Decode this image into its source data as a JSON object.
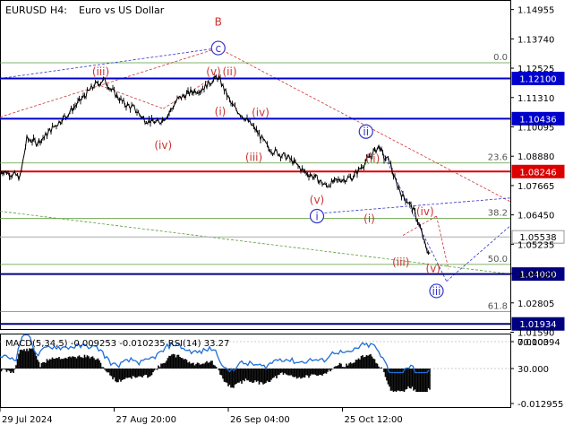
{
  "header": {
    "symbol": "EURUSD",
    "timeframe": "H4:",
    "description": "Euro vs US Dollar"
  },
  "chart_data": {
    "type": "line",
    "price_axis": {
      "ylim": [
        1.0172,
        1.1535
      ],
      "ticks": [
        "1.14955",
        "1.13740",
        "1.12525",
        "1.11310",
        "1.10095",
        "1.08880",
        "1.07665",
        "1.06450",
        "1.05235",
        "1.04020",
        "1.02805",
        "1.01590"
      ]
    },
    "time_axis": {
      "labels": [
        "29 Jul 2024",
        "27 Aug 20:00",
        "26 Sep 04:00",
        "25 Oct 12:00"
      ],
      "label_bars": [
        0,
        170,
        340,
        510
      ]
    },
    "price_series": {
      "name": "EURUSD",
      "anchors": [
        [
          0,
          1.083
        ],
        [
          20,
          1.0812
        ],
        [
          30,
          1.08
        ],
        [
          40,
          1.096
        ],
        [
          55,
          1.0945
        ],
        [
          65,
          1.0965
        ],
        [
          80,
          1.101
        ],
        [
          100,
          1.106
        ],
        [
          120,
          1.112
        ],
        [
          140,
          1.118
        ],
        [
          155,
          1.1205
        ],
        [
          170,
          1.115
        ],
        [
          185,
          1.1105
        ],
        [
          200,
          1.1085
        ],
        [
          215,
          1.104
        ],
        [
          235,
          1.1025
        ],
        [
          250,
          1.106
        ],
        [
          265,
          1.1125
        ],
        [
          285,
          1.1155
        ],
        [
          300,
          1.1165
        ],
        [
          315,
          1.12
        ],
        [
          325,
          1.1215
        ],
        [
          335,
          1.116
        ],
        [
          345,
          1.11
        ],
        [
          360,
          1.106
        ],
        [
          380,
          1.1
        ],
        [
          400,
          1.092
        ],
        [
          430,
          1.088
        ],
        [
          455,
          1.082
        ],
        [
          470,
          1.08
        ],
        [
          485,
          1.0765
        ],
        [
          505,
          1.079
        ],
        [
          525,
          1.08
        ],
        [
          540,
          1.085
        ],
        [
          555,
          1.09
        ],
        [
          565,
          1.093
        ],
        [
          572,
          1.088
        ],
        [
          580,
          1.087
        ],
        [
          588,
          1.079
        ],
        [
          600,
          1.072
        ],
        [
          608,
          1.07
        ],
        [
          615,
          1.067
        ],
        [
          625,
          1.06
        ],
        [
          635,
          1.05
        ],
        [
          640,
          1.049
        ]
      ]
    },
    "horizontal_levels": [
      {
        "price": 1.121,
        "label": "1.12100",
        "color": "#0000cc"
      },
      {
        "price": 1.10436,
        "label": "1.10436",
        "color": "#0000cc"
      },
      {
        "price": 1.08246,
        "label": "1.08246",
        "color": "#dd0000"
      },
      {
        "price": 1.05538,
        "label": "1.05538",
        "color": "#aaaaaa"
      },
      {
        "price": 1.04,
        "label": "1.04000",
        "color": "#000080"
      },
      {
        "price": 1.01934,
        "label": "1.01934",
        "color": "#000080"
      }
    ],
    "fibonacci_levels": [
      {
        "level": "0.0",
        "price": 1.1275
      },
      {
        "level": "23.6",
        "price": 1.086
      },
      {
        "level": "38.2",
        "price": 1.063
      },
      {
        "level": "50.0",
        "price": 1.044
      },
      {
        "level": "61.8",
        "price": 1.0245
      }
    ],
    "wave_labels": [
      {
        "text": "B",
        "bar": 325,
        "price": 1.1445,
        "color": "#cc3333",
        "circle": false
      },
      {
        "text": "c",
        "bar": 325,
        "price": 1.1336,
        "color": "#3333cc",
        "circle": true
      },
      {
        "text": "(iii)",
        "bar": 150,
        "price": 1.124,
        "color": "#cc3333",
        "circle": false
      },
      {
        "text": "(v)",
        "bar": 318,
        "price": 1.124,
        "color": "#cc3333",
        "circle": false
      },
      {
        "text": "(ii)",
        "bar": 342,
        "price": 1.124,
        "color": "#cc3333",
        "circle": false
      },
      {
        "text": "(i)",
        "bar": 328,
        "price": 1.1075,
        "color": "#cc3333",
        "circle": false
      },
      {
        "text": "(iv)",
        "bar": 388,
        "price": 1.107,
        "color": "#cc3333",
        "circle": false
      },
      {
        "text": "(iv)",
        "bar": 243,
        "price": 1.0935,
        "color": "#cc3333",
        "circle": false
      },
      {
        "text": "(iii)",
        "bar": 378,
        "price": 1.0885,
        "color": "#cc3333",
        "circle": false
      },
      {
        "text": "ii",
        "bar": 545,
        "price": 1.099,
        "color": "#3333cc",
        "circle": true
      },
      {
        "text": "(ii)",
        "bar": 555,
        "price": 1.088,
        "color": "#cc3333",
        "circle": false
      },
      {
        "text": "(v)",
        "bar": 472,
        "price": 1.0708,
        "color": "#cc3333",
        "circle": false
      },
      {
        "text": "i",
        "bar": 472,
        "price": 1.064,
        "color": "#3333cc",
        "circle": true
      },
      {
        "text": "(i)",
        "bar": 550,
        "price": 1.063,
        "color": "#cc3333",
        "circle": false
      },
      {
        "text": "(iv)",
        "bar": 633,
        "price": 1.066,
        "color": "#cc3333",
        "circle": false
      },
      {
        "text": "(iii)",
        "bar": 597,
        "price": 1.045,
        "color": "#cc3333",
        "circle": false
      },
      {
        "text": "(v)",
        "bar": 645,
        "price": 1.0425,
        "color": "#cc3333",
        "circle": false
      },
      {
        "text": "iii",
        "bar": 650,
        "price": 1.033,
        "color": "#3333cc",
        "circle": true
      }
    ],
    "indicator": {
      "label": "MACD(5,34,5) -0.009253 -0.010235 RSI(14) 33.27",
      "ticks": [
        "0.010394",
        "70.000",
        "30.000",
        "-0.012955"
      ]
    }
  }
}
